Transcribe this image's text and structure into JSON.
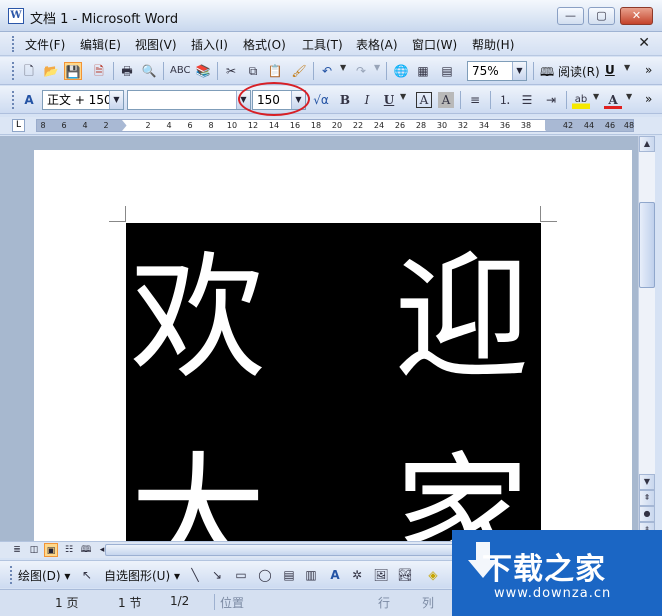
{
  "window": {
    "title": "文档 1 - Microsoft Word",
    "app_icon": "W",
    "minimize": "—",
    "restore": "▢",
    "close": "✕"
  },
  "menu": {
    "items": [
      "文件(F)",
      "编辑(E)",
      "视图(V)",
      "插入(I)",
      "格式(O)",
      "工具(T)",
      "表格(A)",
      "窗口(W)",
      "帮助(H)"
    ],
    "close_doc": "✕"
  },
  "standard_toolbar": {
    "zoom": "75%",
    "read_label": "阅读(R)",
    "u_label": "U"
  },
  "format_toolbar": {
    "style": "正文 + 150",
    "font": "",
    "font_size": "150",
    "bold": "B",
    "italic": "I",
    "underline": "U",
    "char_border": "A",
    "char_shading": "A",
    "font_color": "A"
  },
  "ruler": {
    "tab_selector": "L",
    "left_numbers": [
      "8",
      "6",
      "4",
      "2"
    ],
    "right_numbers": [
      "2",
      "4",
      "6",
      "8",
      "10",
      "12",
      "14",
      "16",
      "18",
      "20",
      "22",
      "24",
      "26",
      "28",
      "30",
      "32",
      "34",
      "36",
      "38",
      "42",
      "44",
      "46",
      "48"
    ]
  },
  "document": {
    "characters": [
      "欢",
      "迎",
      "大",
      "家"
    ]
  },
  "drawing_toolbar": {
    "draw_label": "绘图(D)",
    "autoshape_label": "自选图形(U)"
  },
  "status": {
    "page": "1 页",
    "section": "1 节",
    "page_of": "1/2",
    "position": "位置",
    "line": "行",
    "column": "列"
  },
  "watermark": {
    "title": "下载之家",
    "url": "www.downza.cn"
  },
  "colors": {
    "accent": "#d71f26",
    "watermark_bg": "#1b66c4"
  }
}
